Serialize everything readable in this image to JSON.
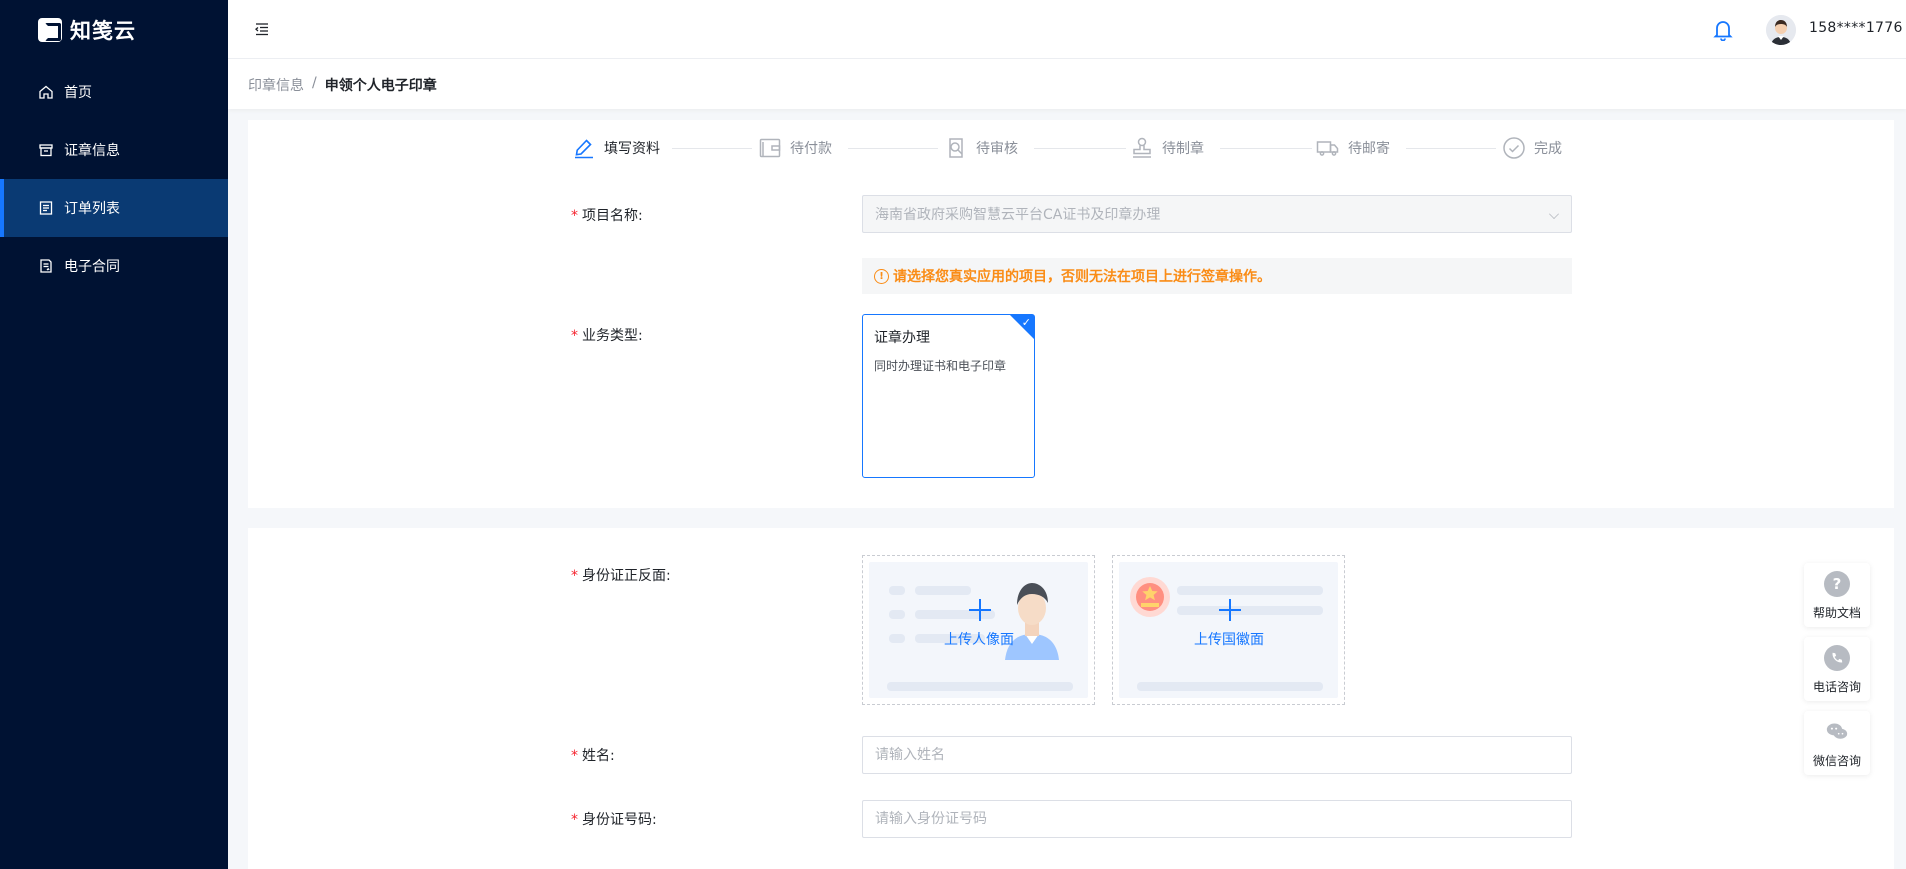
{
  "brand": {
    "name": "知笺云"
  },
  "sidebar": {
    "items": [
      {
        "label": "首页",
        "icon": "home-icon"
      },
      {
        "label": "证章信息",
        "icon": "box-icon"
      },
      {
        "label": "订单列表",
        "icon": "list-icon",
        "active": true
      },
      {
        "label": "电子合同",
        "icon": "contract-icon"
      }
    ]
  },
  "header": {
    "user_phone": "158****1776"
  },
  "breadcrumb": {
    "parent": "印章信息",
    "separator": "/",
    "current": "申领个人电子印章"
  },
  "steps": [
    {
      "label": "填写资料",
      "icon": "edit-icon",
      "active": true
    },
    {
      "label": "待付款",
      "icon": "wallet-icon"
    },
    {
      "label": "待审核",
      "icon": "review-icon"
    },
    {
      "label": "待制章",
      "icon": "stamp-icon"
    },
    {
      "label": "待邮寄",
      "icon": "truck-icon"
    },
    {
      "label": "完成",
      "icon": "check-circle-icon"
    }
  ],
  "form": {
    "required_mark": "*",
    "project": {
      "label": "项目名称:",
      "value": "海南省政府采购智慧云平台CA证书及印章办理"
    },
    "warning": "请选择您真实应用的项目，否则无法在项目上进行签章操作。",
    "business_type": {
      "label": "业务类型:",
      "card_title": "证章办理",
      "card_desc": "同时办理证书和电子印章"
    },
    "id_card": {
      "label": "身份证正反面:",
      "front_text": "上传人像面",
      "back_text": "上传国徽面"
    },
    "name": {
      "label": "姓名:",
      "placeholder": "请输入姓名"
    },
    "id_number": {
      "label": "身份证号码:",
      "placeholder": "请输入身份证号码"
    }
  },
  "float_tools": [
    {
      "label": "帮助文档",
      "icon": "help-icon"
    },
    {
      "label": "电话咨询",
      "icon": "phone-icon"
    },
    {
      "label": "微信咨询",
      "icon": "wechat-icon"
    }
  ],
  "colors": {
    "sidebar_bg": "#001233",
    "active_nav": "#0a3a73",
    "accent": "#1677ff",
    "warning": "#fa8c16",
    "required": "#f5222d"
  }
}
